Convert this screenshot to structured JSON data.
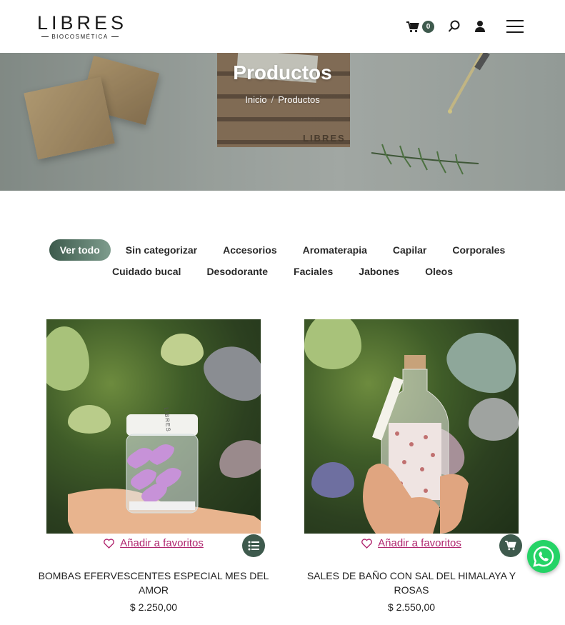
{
  "brand": {
    "name": "LIBRES",
    "tagline": "BIOCOSMÉTICA"
  },
  "header": {
    "cart_count": "0",
    "icons": [
      "cart-icon",
      "search-icon",
      "user-icon",
      "menu-icon"
    ]
  },
  "hero": {
    "title": "Productos",
    "crate_text": "LIBRES",
    "breadcrumb": {
      "home": "Inicio",
      "separator": "/",
      "current": "Productos"
    }
  },
  "filters": {
    "row1": [
      "Ver todo",
      "Sin categorizar",
      "Accesorios",
      "Aromaterapia",
      "Capilar",
      "Corporales"
    ],
    "row2": [
      "Cuidado bucal",
      "Desodorante",
      "Faciales",
      "Jabones",
      "Oleos"
    ],
    "active": "Ver todo"
  },
  "products": [
    {
      "name": "BOMBAS EFERVESCENTES ESPECIAL MES DEL AMOR",
      "price": "$ 2.250,00",
      "favorite_label": "Añadir a favoritos",
      "action_icon": "list-icon",
      "jar_label": "LIBRES"
    },
    {
      "name": "SALES DE BAÑO CON SAL DEL HIMALAYA Y ROSAS",
      "price": "$ 2.550,00",
      "favorite_label": "Añadir a favoritos",
      "action_icon": "cart-icon"
    }
  ],
  "colors": {
    "accent": "#3e5a4d",
    "link": "#b0256e",
    "whatsapp": "#25d366"
  }
}
